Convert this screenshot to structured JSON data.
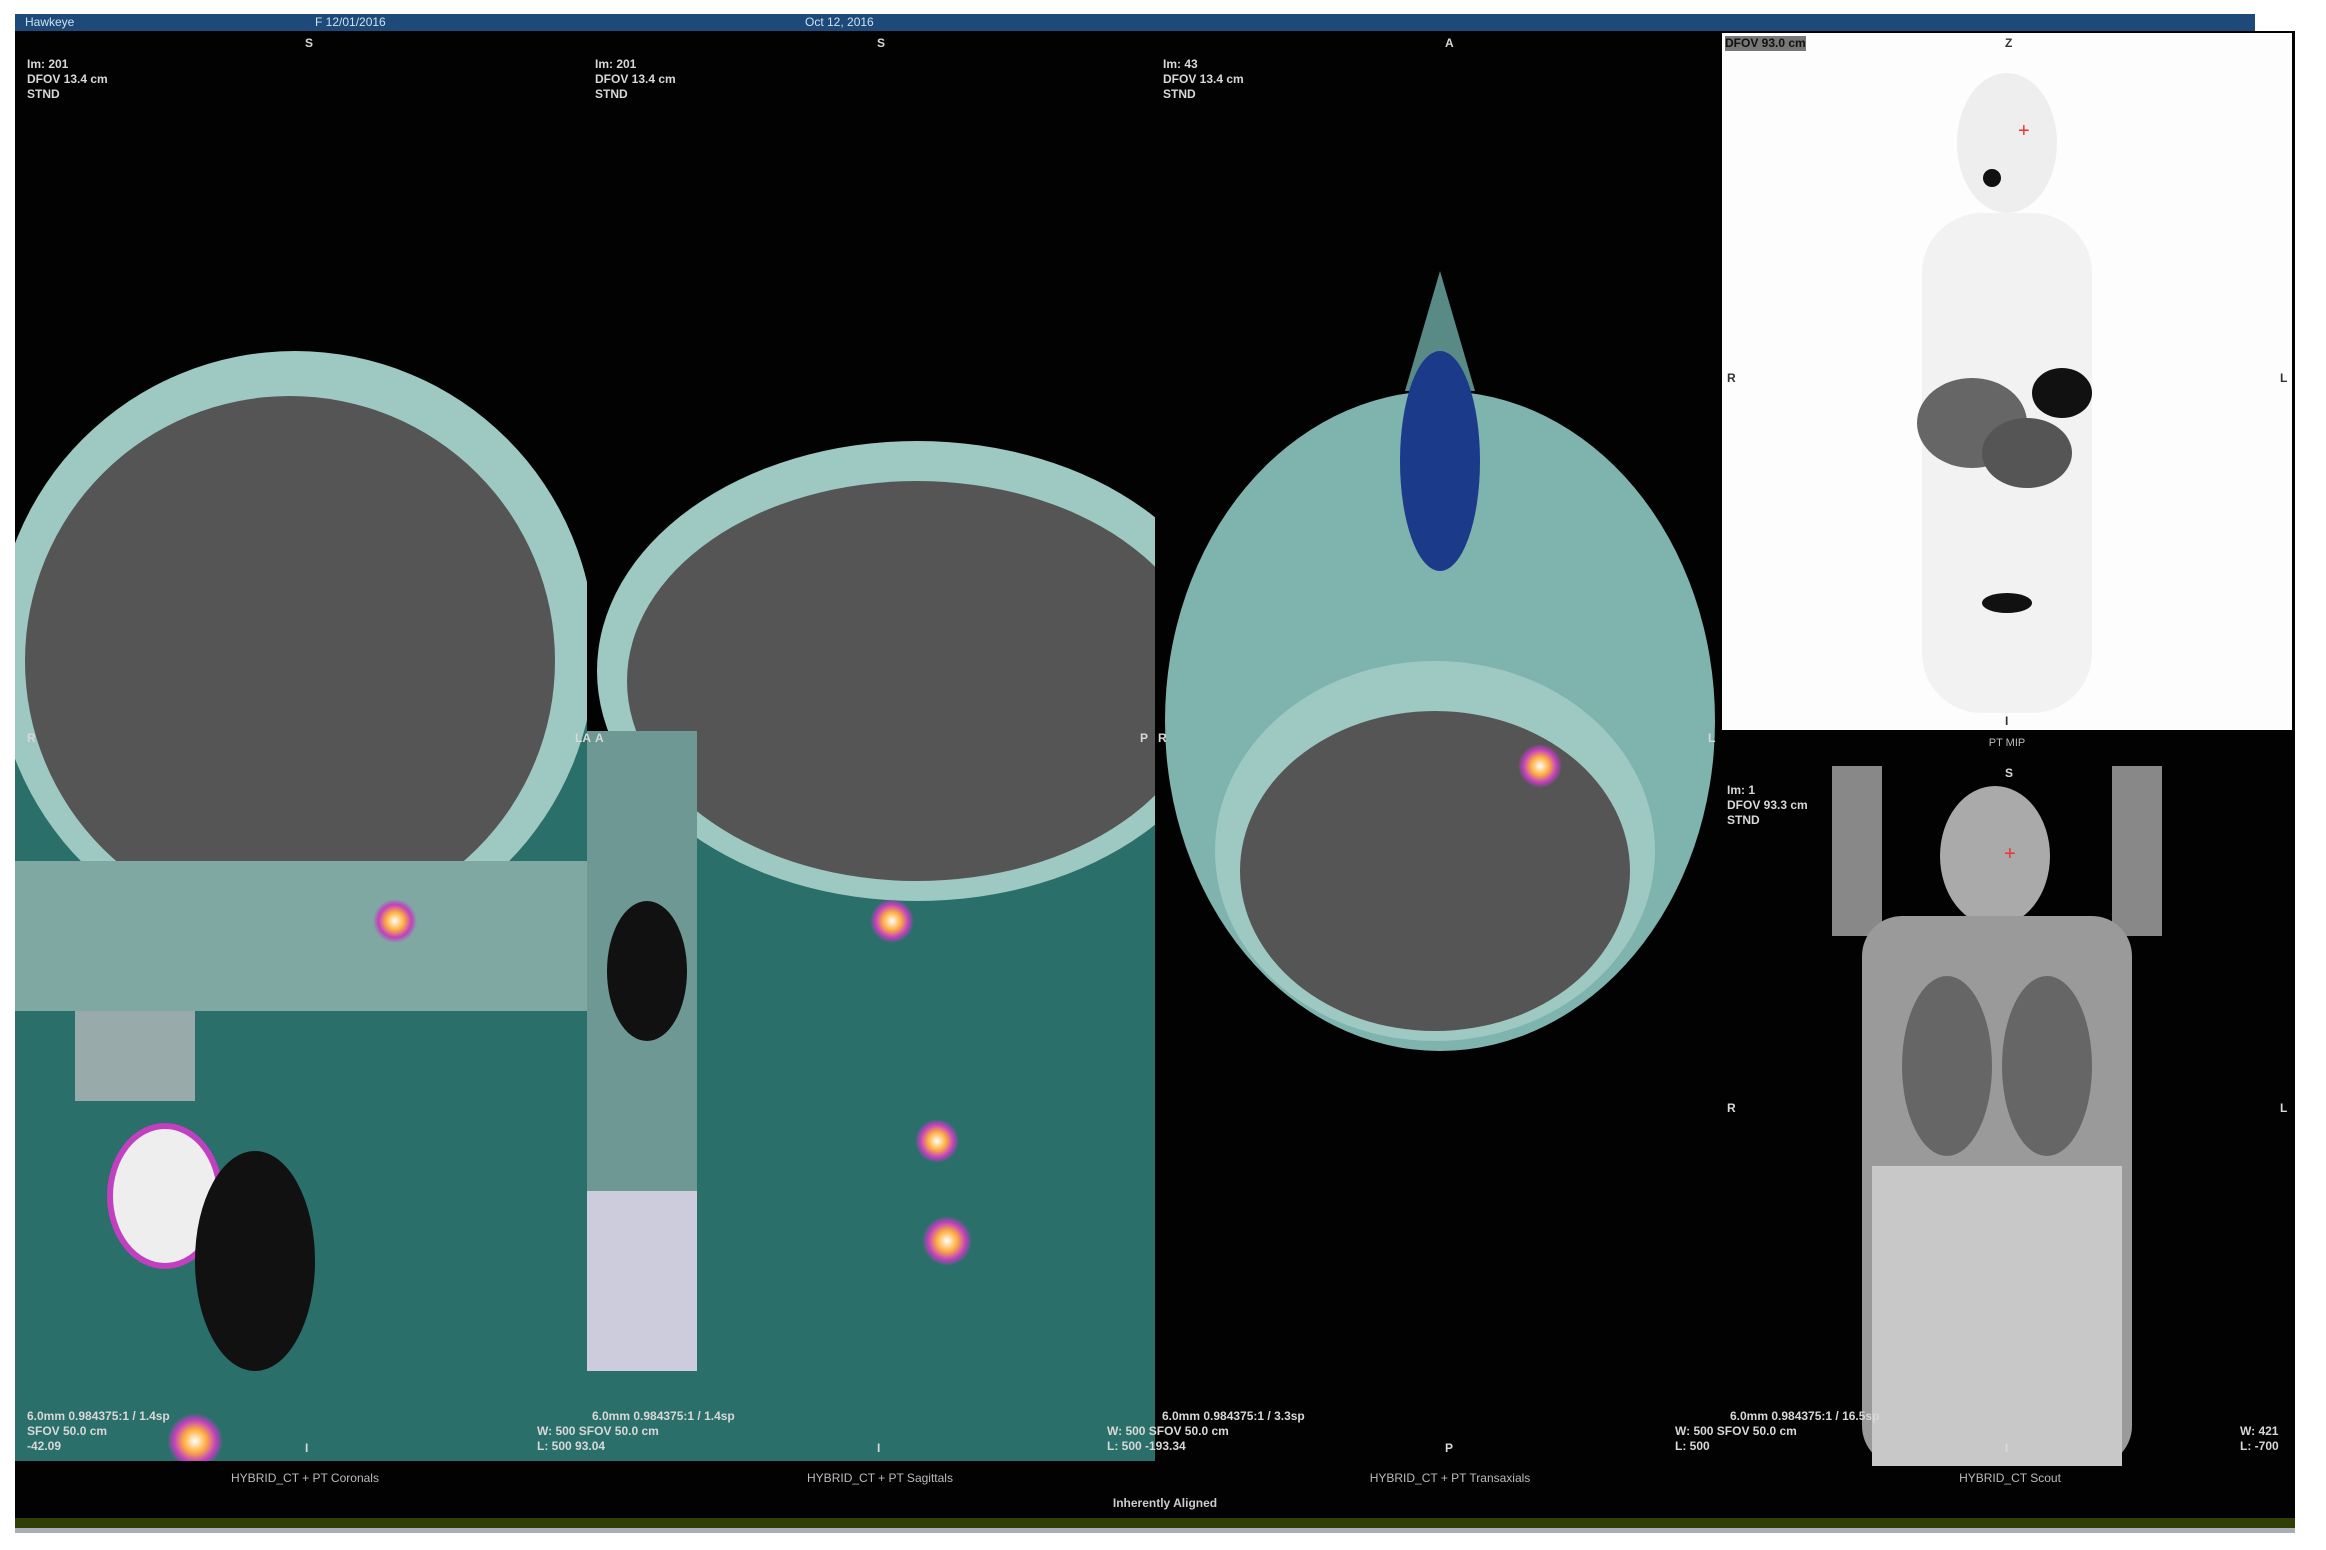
{
  "topbar": {
    "patient": "Hawkeye",
    "id": "F 12/01/2016",
    "date": "Oct 12, 2016"
  },
  "panels": [
    {
      "name": "coronal",
      "top_lines": [
        "Im: 201",
        "DFOV 13.4 cm",
        "STND"
      ],
      "orient": {
        "top": "S",
        "left": "R",
        "right": "LA",
        "bottom": "I"
      },
      "bottom_lines": [
        "6.0mm 0.984375:1 / 1.4sp",
        "SFOV 50.0 cm",
        "-42.09"
      ],
      "caption": "HYBRID_CT + PT Coronals"
    },
    {
      "name": "sagittal",
      "top_lines": [
        "Im: 201",
        "DFOV 13.4 cm",
        "STND"
      ],
      "orient": {
        "top": "S",
        "left": "A",
        "right": "P",
        "bottom": "I"
      },
      "bottom_lines": [
        "6.0mm 0.984375:1 / 1.4sp",
        "W: 500 SFOV 50.0 cm",
        "L: 500 93.04"
      ],
      "caption": "HYBRID_CT + PT Sagittals"
    },
    {
      "name": "transaxial",
      "top_lines": [
        "Im: 43",
        "DFOV 13.4 cm",
        "STND"
      ],
      "orient": {
        "top": "A",
        "left": "R",
        "right": "L",
        "bottom": "P"
      },
      "bottom_lines": [
        "6.0mm 0.984375:1 / 3.3sp",
        "W: 500 SFOV 50.0 cm",
        "L: 500 -193.34"
      ],
      "caption": "HYBRID_CT + PT Transaxials"
    },
    {
      "name": "scout",
      "top_lines": [
        "Im: 1",
        "DFOV 93.3 cm",
        "STND"
      ],
      "orient": {
        "top": "S",
        "left": "R",
        "right": "L",
        "bottom": "I"
      },
      "bottom_lines": [
        "6.0mm 0.984375:1 / 16.5sp",
        "W: 500 SFOV 50.0 cm",
        "L: 500"
      ],
      "right_lines": [
        "W: 421",
        "L: -700"
      ],
      "caption": "HYBRID_CT Scout"
    }
  ],
  "mip": {
    "label": "DFOV 93.0 cm",
    "orient": {
      "top": "Z",
      "left": "R",
      "right": "L",
      "bottom": "I"
    },
    "caption": "PT MIP"
  },
  "footer": "Inherently Aligned"
}
